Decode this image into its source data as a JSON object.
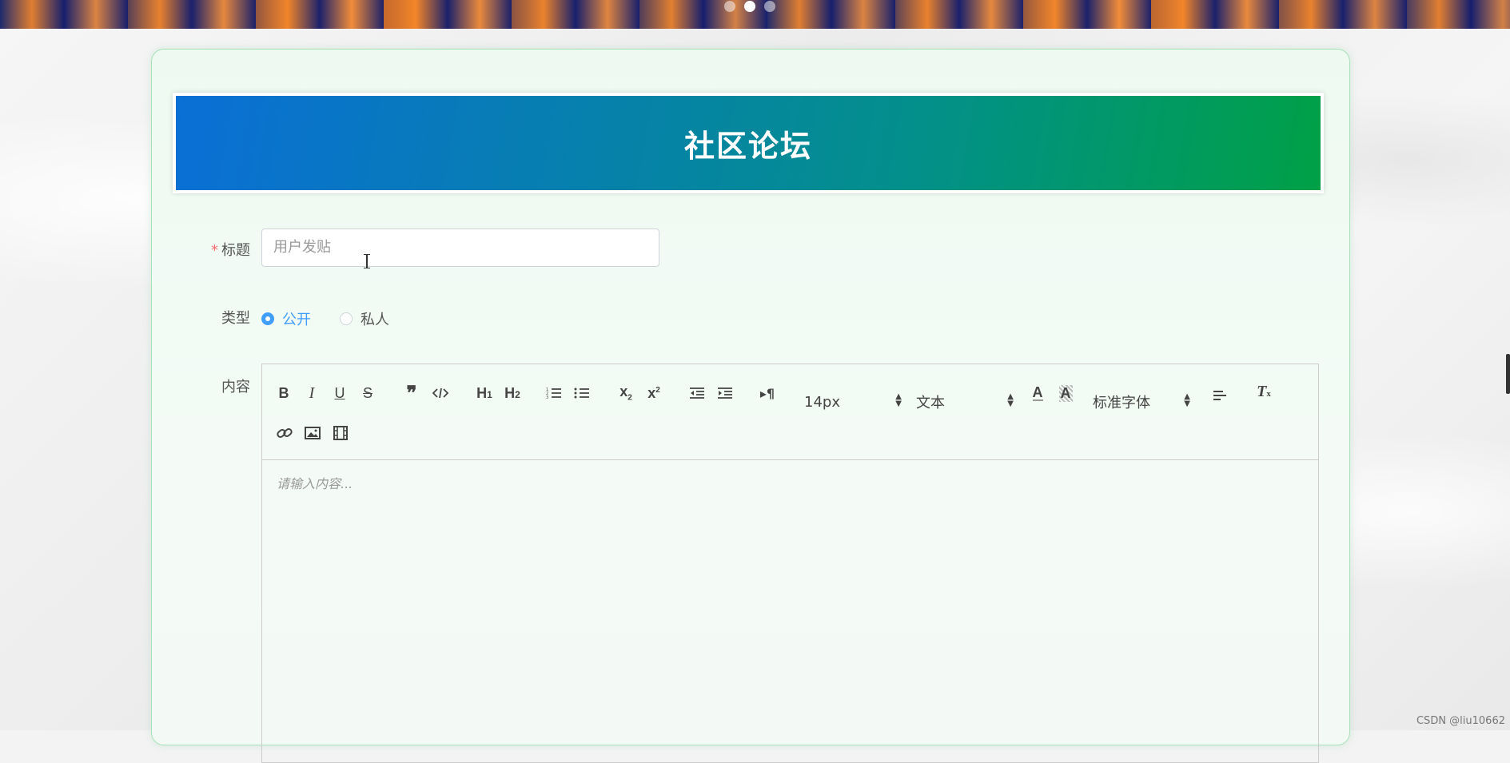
{
  "header": {
    "title": "社区论坛"
  },
  "form": {
    "title_label": "标题",
    "required_mark": "*",
    "title_placeholder": "用户发贴",
    "type_label": "类型",
    "type_options": [
      "公开",
      "私人"
    ],
    "type_selected": "公开",
    "content_label": "内容"
  },
  "editor": {
    "font_size": "14px",
    "header_picker": "文本",
    "font_family": "标准字体",
    "placeholder": "请输入内容..."
  },
  "carousel": {
    "count": 3,
    "active_index": 1
  },
  "watermark": "CSDN @liu10662",
  "colors": {
    "accent": "#409eff",
    "required": "#f56c6c",
    "header_start": "#0a6fd6",
    "header_end": "#00a046"
  }
}
